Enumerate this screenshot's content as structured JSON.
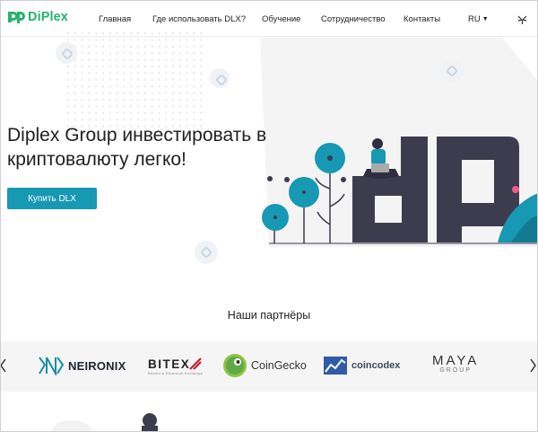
{
  "header": {
    "logo_text": "DiPlex",
    "nav": [
      {
        "label": "Главная"
      },
      {
        "label": "Где использовать DLX?"
      },
      {
        "label": "Обучение"
      },
      {
        "label": "Сотрудничество"
      },
      {
        "label": "Контакты"
      }
    ],
    "language": "RU",
    "lang_icon": "chevron-down-icon",
    "gift_icon": "gift-icon"
  },
  "hero": {
    "title": "Diplex Group инвестировать в криптовалюту легко!",
    "cta_label": "Купить DLX"
  },
  "partners": {
    "title": "Наши партнёры",
    "items": [
      {
        "name": "NEIRONIX",
        "icon": "neironix-logo"
      },
      {
        "name": "BITEX",
        "sub": "Bitcoin & Ethereum Exchange",
        "icon": "bitex-logo"
      },
      {
        "name": "CoinGecko",
        "icon": "coingecko-logo"
      },
      {
        "name": "coincodex",
        "icon": "coincodex-logo"
      },
      {
        "name": "MAYA",
        "sub": "GROUP",
        "icon": "maya-logo"
      }
    ],
    "prev_icon": "chevron-left-icon",
    "next_icon": "chevron-right-icon"
  },
  "colors": {
    "brand_green": "#25b36b",
    "button_teal": "#1798b3",
    "illustration_dark": "#3d3c4f",
    "illustration_teal": "#1798b3"
  }
}
